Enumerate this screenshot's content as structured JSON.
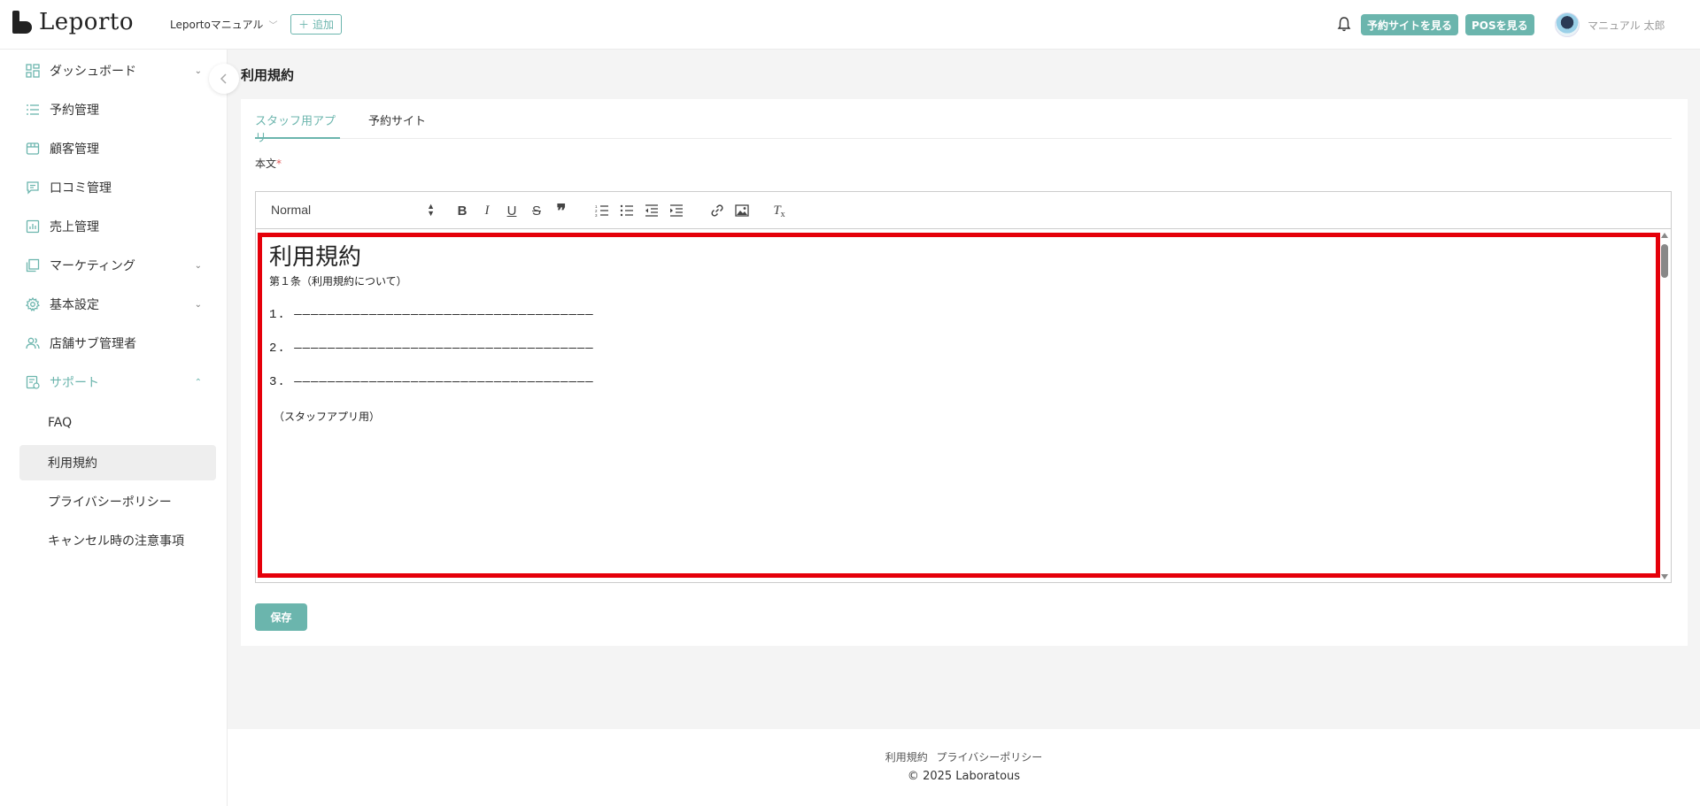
{
  "header": {
    "logo_text": "Leporto",
    "store_name": "Leportoマニュアル",
    "add_label": "追加",
    "reserve_site_label": "予約サイトを見る",
    "pos_label": "POSを見る",
    "user_name": "マニュアル 太郎"
  },
  "sidebar": {
    "items": [
      {
        "label": "ダッシュボード",
        "icon": "dashboard-icon"
      },
      {
        "label": "予約管理",
        "icon": "list-icon"
      },
      {
        "label": "顧客管理",
        "icon": "customer-icon"
      },
      {
        "label": "口コミ管理",
        "icon": "review-icon"
      },
      {
        "label": "売上管理",
        "icon": "sales-chart-icon"
      },
      {
        "label": "マーケティング",
        "icon": "marketing-icon"
      },
      {
        "label": "基本設定",
        "icon": "gear-icon"
      },
      {
        "label": "店舗サブ管理者",
        "icon": "users-icon"
      },
      {
        "label": "サポート",
        "icon": "support-icon"
      }
    ],
    "support_sub": [
      {
        "label": "FAQ"
      },
      {
        "label": "利用規約"
      },
      {
        "label": "プライバシーポリシー"
      },
      {
        "label": "キャンセル時の注意事項"
      }
    ]
  },
  "main": {
    "page_title": "利用規約",
    "tabs": [
      {
        "label": "スタッフ用アプリ"
      },
      {
        "label": "予約サイト"
      }
    ],
    "field_label": "本文",
    "required_mark": "*",
    "editor": {
      "format_select": "Normal",
      "heading": "利用規約",
      "article": "第１条（利用規約について）",
      "lines": [
        "1. ————————————————————————————————————",
        "2. ————————————————————————————————————",
        "3. ————————————————————————————————————"
      ],
      "note": "（スタッフアプリ用）"
    },
    "save_label": "保存"
  },
  "footer": {
    "link_terms": "利用規約",
    "link_privacy": "プライバシーポリシー",
    "copyright": "2025 Laboratous"
  },
  "colors": {
    "accent": "#6bb5ad",
    "highlight": "#e5000a"
  }
}
